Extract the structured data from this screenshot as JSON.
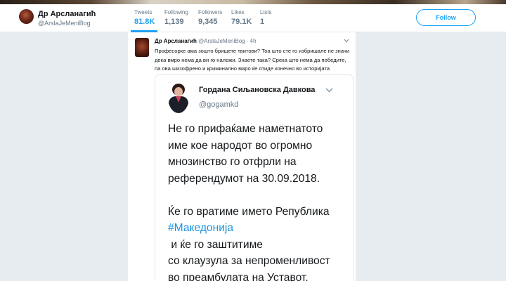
{
  "profile": {
    "name": "Др Арсланагиħ",
    "handle": "@ArslaJeMeniBog"
  },
  "stats": [
    {
      "label": "Tweets",
      "value": "81.8K"
    },
    {
      "label": "Following",
      "value": "1,139"
    },
    {
      "label": "Followers",
      "value": "9,345"
    },
    {
      "label": "Likes",
      "value": "79.1K"
    },
    {
      "label": "Lists",
      "value": "1"
    }
  ],
  "follow_label": "Follow",
  "tweet": {
    "name": "Др Арсланагиħ",
    "handle": "@ArslaJeMeniBog",
    "separator": "·",
    "time": "4h",
    "text_lines": [
      "Професорке ама зошто бришете твитови? Тоа што сте го избришале не значи",
      "дека вмро нема да ви го наложи. Знаете така? Срека што нема да победите,",
      "па ова шизофрено и криминално вмро ќе отиде конечно во историјата"
    ]
  },
  "embedded_tweet": {
    "name": "Гордана Сиљановска Давкова",
    "handle": "@gogamkd",
    "paragraph1": [
      "Не го прифаќаме наметнатото",
      "име кое народот во огромно",
      "мнозинство го отфрли на",
      "референдумот на 30.09.2018."
    ],
    "paragraph2_line1": "Ќе го вратиме името Република",
    "hashtag": "#Македонија",
    "paragraph2_line2_rest": " и ќе го заштитиме",
    "paragraph2_rest": [
      "со клаузула за непроменливост",
      "во преамбулата на Уставот."
    ]
  },
  "colors": {
    "accent": "#1da1f2",
    "hashtag": "#1b95e0",
    "background": "#e6ecf0",
    "secondary_text": "#657786"
  },
  "icons": {
    "tweet_menu": "chevron-down-icon",
    "embedded_menu": "chevron-down-icon"
  }
}
